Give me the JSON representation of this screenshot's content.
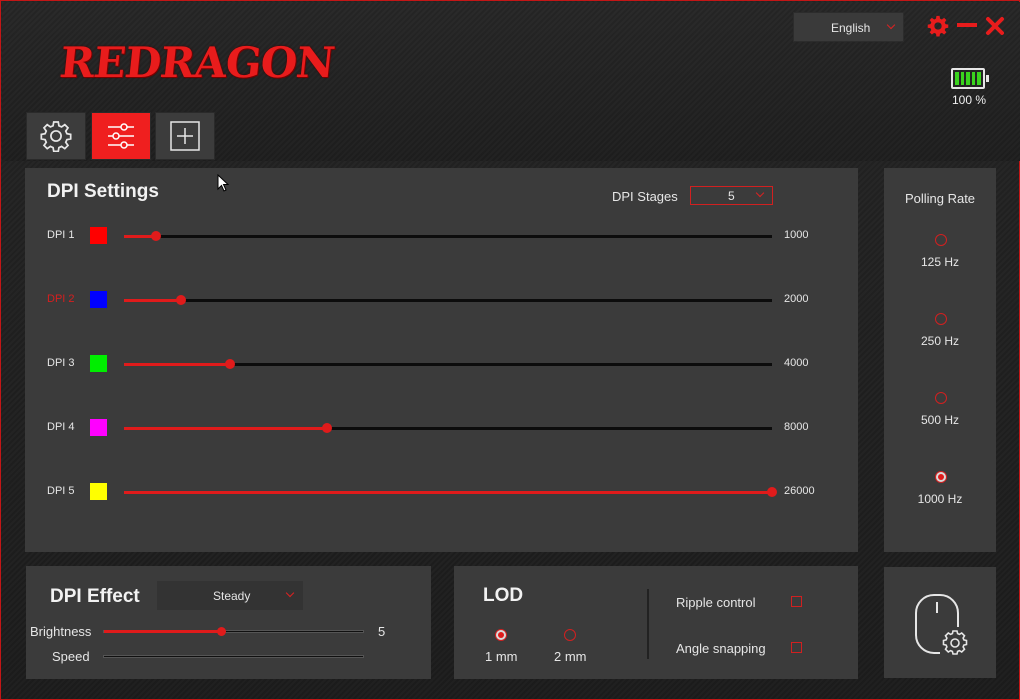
{
  "app": {
    "logo": "REDRAGON",
    "language": "English",
    "battery_percent": "100 %",
    "battery_level": 1.0
  },
  "tabs": [
    {
      "name": "settings",
      "icon": "gear-icon",
      "active": false
    },
    {
      "name": "adjust",
      "icon": "sliders-icon",
      "active": true
    },
    {
      "name": "macro",
      "icon": "plus-square-icon",
      "active": false
    }
  ],
  "dpi_settings": {
    "title": "DPI Settings",
    "stages_label": "DPI Stages",
    "stages_value": "5",
    "max_dpi": 26000,
    "rows": [
      {
        "label": "DPI 1",
        "color": "#ff0000",
        "value": "1000",
        "selected": false
      },
      {
        "label": "DPI 2",
        "color": "#0000ff",
        "value": "2000",
        "selected": true
      },
      {
        "label": "DPI 3",
        "color": "#00ee00",
        "value": "4000",
        "selected": false
      },
      {
        "label": "DPI 4",
        "color": "#ff00ff",
        "value": "8000",
        "selected": false
      },
      {
        "label": "DPI 5",
        "color": "#ffff00",
        "value": "26000",
        "selected": false
      }
    ]
  },
  "polling": {
    "title": "Polling Rate",
    "options": [
      {
        "label": "125 Hz",
        "selected": false
      },
      {
        "label": "250 Hz",
        "selected": false
      },
      {
        "label": "500 Hz",
        "selected": false
      },
      {
        "label": "1000 Hz",
        "selected": true
      }
    ]
  },
  "dpi_effect": {
    "title": "DPI Effect",
    "mode": "Steady",
    "brightness_label": "Brightness",
    "brightness_value": "5",
    "brightness_fraction": 0.45,
    "speed_label": "Speed",
    "speed_fraction": 0.0
  },
  "lod": {
    "title": "LOD",
    "options": [
      {
        "label": "1 mm",
        "selected": true
      },
      {
        "label": "2 mm",
        "selected": false
      }
    ],
    "ripple_label": "Ripple control",
    "ripple_checked": false,
    "angle_label": "Angle snapping",
    "angle_checked": false
  },
  "colors": {
    "accent": "#e01b1b",
    "panel": "#3b3b3b",
    "battery": "#3ad31e"
  }
}
